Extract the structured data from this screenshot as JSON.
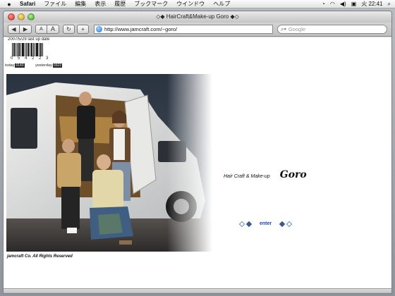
{
  "menubar": {
    "app": "Safari",
    "items": [
      "ファイル",
      "編集",
      "表示",
      "履歴",
      "ブックマーク",
      "ウインドウ",
      "ヘルプ"
    ],
    "clock": "火 22:41"
  },
  "window": {
    "title": "◇◆ HairCraft&Make-up Goro ◆◇",
    "url": "http://www.jamcraft.com/~goro/",
    "search_placeholder": "Google"
  },
  "page": {
    "last_update": "2007/5/29 last up date",
    "barcode_number": "0 5 4 2 2 3",
    "today_label": "today",
    "today_count": "0143",
    "yesterday_label": "yesterday",
    "yesterday_count": "0322",
    "brand_sub": "Hair Craft & Make-up",
    "brand_name": "Goro",
    "enter": "enter",
    "copyright": "jamcraft Co. All Rights Reserved"
  },
  "colors": {
    "accent": "#1a3fb8",
    "diamond": "#3a5b8c"
  }
}
